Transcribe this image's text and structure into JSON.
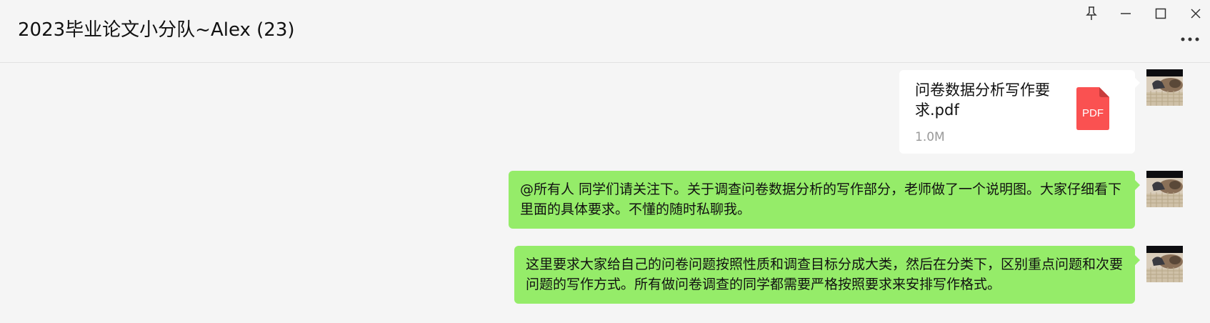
{
  "window": {
    "title": "2023毕业论文小分队~Alex (23)",
    "controls": [
      "pin",
      "minimize",
      "maximize",
      "close",
      "more"
    ]
  },
  "messages": [
    {
      "type": "file",
      "file_name": "问卷数据分析写作要求.pdf",
      "file_size": "1.0M",
      "file_icon_label": "PDF"
    },
    {
      "type": "text",
      "text": "@所有人 同学们请关注下。关于调查问卷数据分析的写作部分，老师做了一个说明图。大家仔细看下里面的具体要求。不懂的随时私聊我。"
    },
    {
      "type": "text",
      "text": "这里要求大家给自己的问卷问题按照性质和调查目标分成大类，然后在分类下，区别重点问题和次要问题的写作方式。所有做问卷调查的同学都需要严格按照要求来安排写作格式。"
    }
  ],
  "colors": {
    "bubble_green": "#95ec69",
    "background": "#f5f5f5",
    "pdf_red": "#fa5151"
  }
}
